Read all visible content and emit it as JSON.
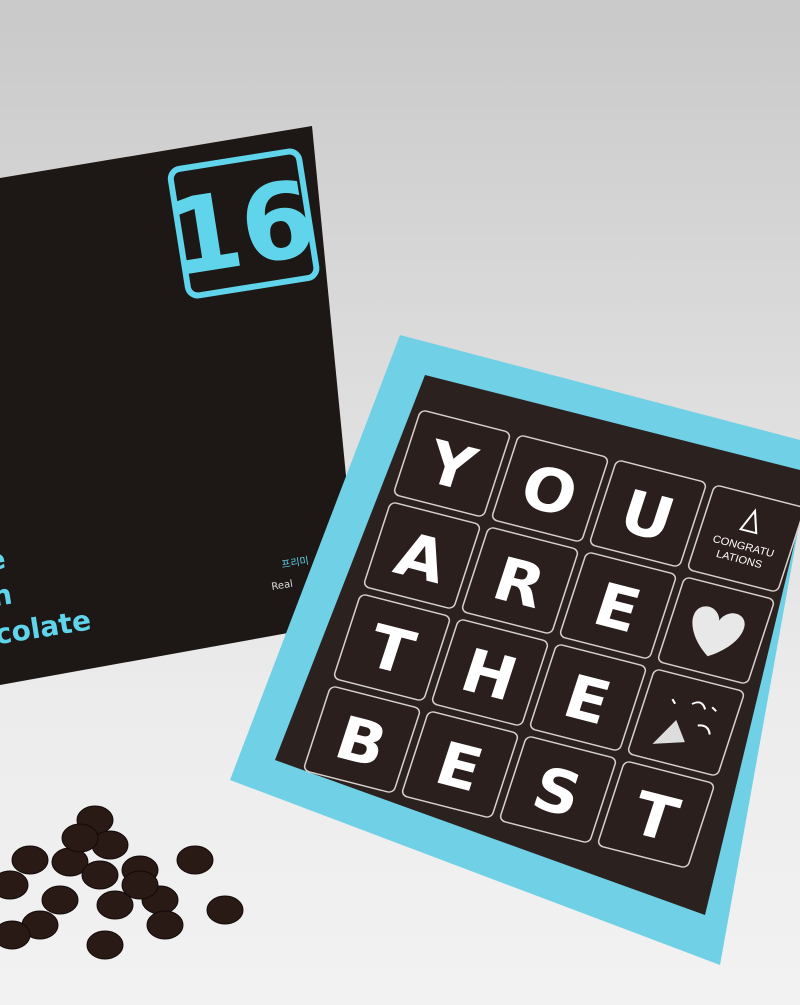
{
  "lid": {
    "logo_number": "16",
    "title_lines": [
      "e",
      "n",
      "colate"
    ],
    "korean_text": "프리미",
    "small_text": "Real"
  },
  "tiles": [
    [
      "Y",
      "O",
      "U",
      "CONGRATU|LATIONS"
    ],
    [
      "A",
      "R",
      "E",
      "heart"
    ],
    [
      "T",
      "H",
      "E",
      "party-popper"
    ],
    [
      "B",
      "E",
      "S",
      "T"
    ]
  ],
  "message": {
    "row1": [
      "Y",
      "O",
      "U"
    ],
    "row2": [
      "A",
      "R",
      "E"
    ],
    "row3": [
      "T",
      "H",
      "E"
    ],
    "row4": [
      "B",
      "E",
      "S",
      "T"
    ],
    "card_line1": "CONGRATU",
    "card_line2": "LATIONS"
  },
  "colors": {
    "accent": "#5fd4ea",
    "chocolate": "#2a1f1c",
    "lid": "#1e1816",
    "tray": "#6fd0e6"
  }
}
